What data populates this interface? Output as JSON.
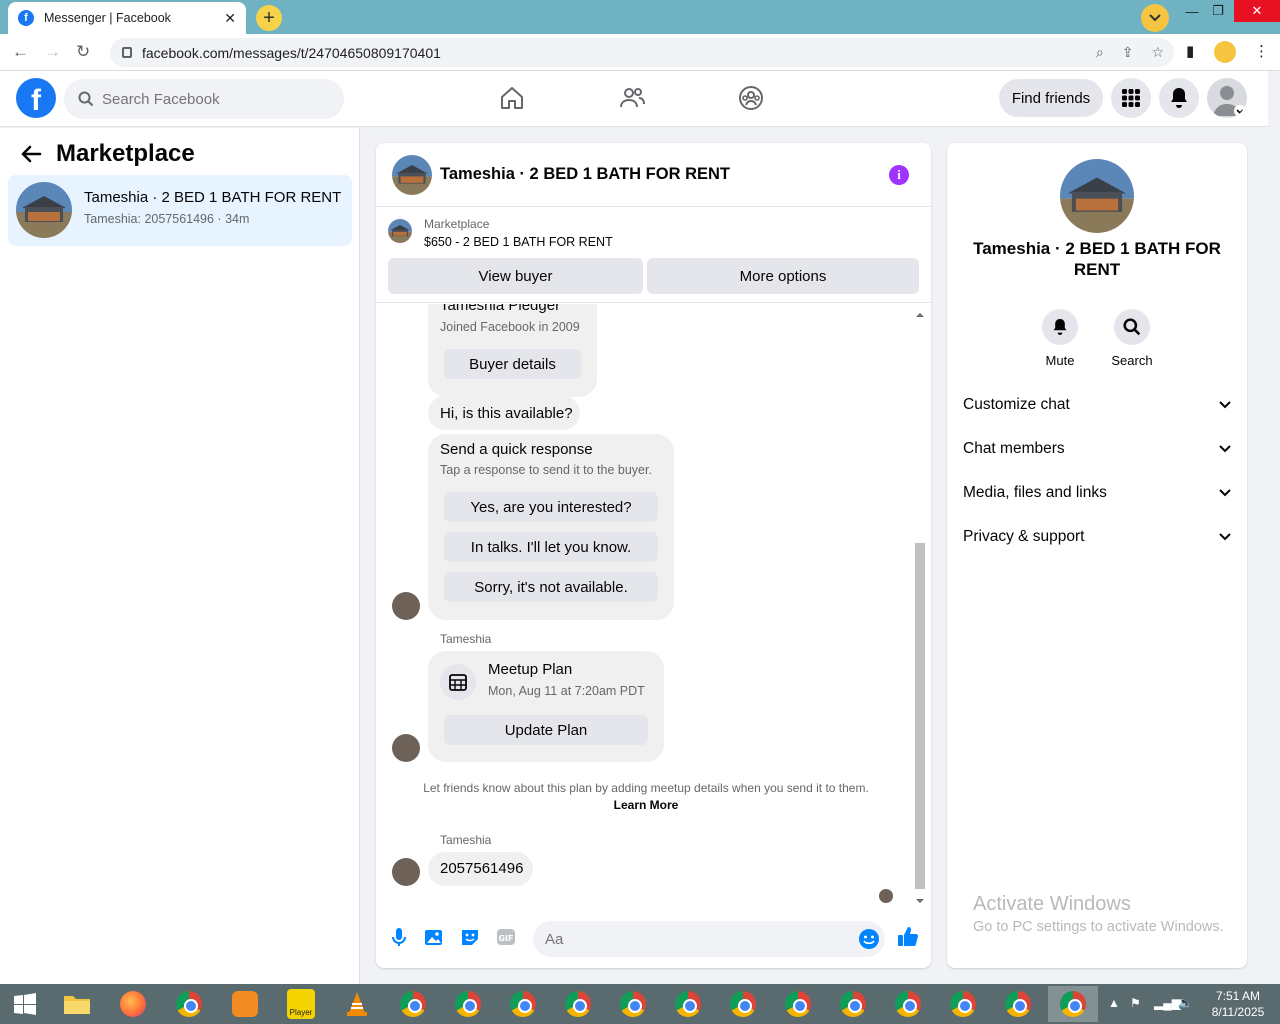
{
  "browser": {
    "tab_title": "Messenger | Facebook",
    "url": "facebook.com/messages/t/24704650809170401"
  },
  "fb": {
    "search_placeholder": "Search Facebook",
    "find_friends": "Find friends"
  },
  "sidebar": {
    "title": "Marketplace",
    "conversations": [
      {
        "name": "Tameshia · 2 BED 1 BATH FOR RENT",
        "preview": "Tameshia: 2057561496 · 34m"
      }
    ]
  },
  "chat": {
    "header_name": "Tameshia · 2 BED 1 BATH FOR RENT",
    "listing": {
      "label": "Marketplace",
      "price_title": "$650 - 2 BED 1 BATH FOR RENT",
      "view_buyer": "View buyer",
      "more_options": "More options"
    },
    "buyer_card": {
      "name": "Tameshia Pledger",
      "joined": "Joined Facebook in 2009",
      "button": "Buyer details"
    },
    "message1": "Hi, is this available?",
    "quick_response": {
      "title": "Send a quick response",
      "subtitle": "Tap a response to send it to the buyer.",
      "options": [
        "Yes, are you interested?",
        "In talks. I'll let you know.",
        "Sorry, it's not available."
      ]
    },
    "sender_name": "Tameshia",
    "meetup": {
      "title": "Meetup Plan",
      "time": "Mon, Aug 11 at 7:20am PDT",
      "button": "Update Plan"
    },
    "note": "Let friends know about this plan by adding meetup details when you send it to them.",
    "learn_more": "Learn More",
    "sender_name2": "Tameshia",
    "message2": "2057561496",
    "composer_placeholder": "Aa"
  },
  "right_panel": {
    "name": "Tameshia · 2 BED 1 BATH FOR RENT",
    "actions": [
      {
        "label": "Mute",
        "icon": "bell-icon"
      },
      {
        "label": "Search",
        "icon": "search-icon"
      }
    ],
    "sections": [
      "Customize chat",
      "Chat members",
      "Media, files and links",
      "Privacy & support"
    ],
    "watermark_title": "Activate Windows",
    "watermark_sub": "Go to PC settings to activate Windows."
  },
  "taskbar": {
    "time": "7:51 AM",
    "date": "8/11/2025",
    "player_label": "Player"
  },
  "colors": {
    "fb_blue": "#1877f2",
    "info_purple": "#a033ff",
    "selected_bg": "#e7f3ff",
    "bubble_gray": "#f0f0f0"
  }
}
